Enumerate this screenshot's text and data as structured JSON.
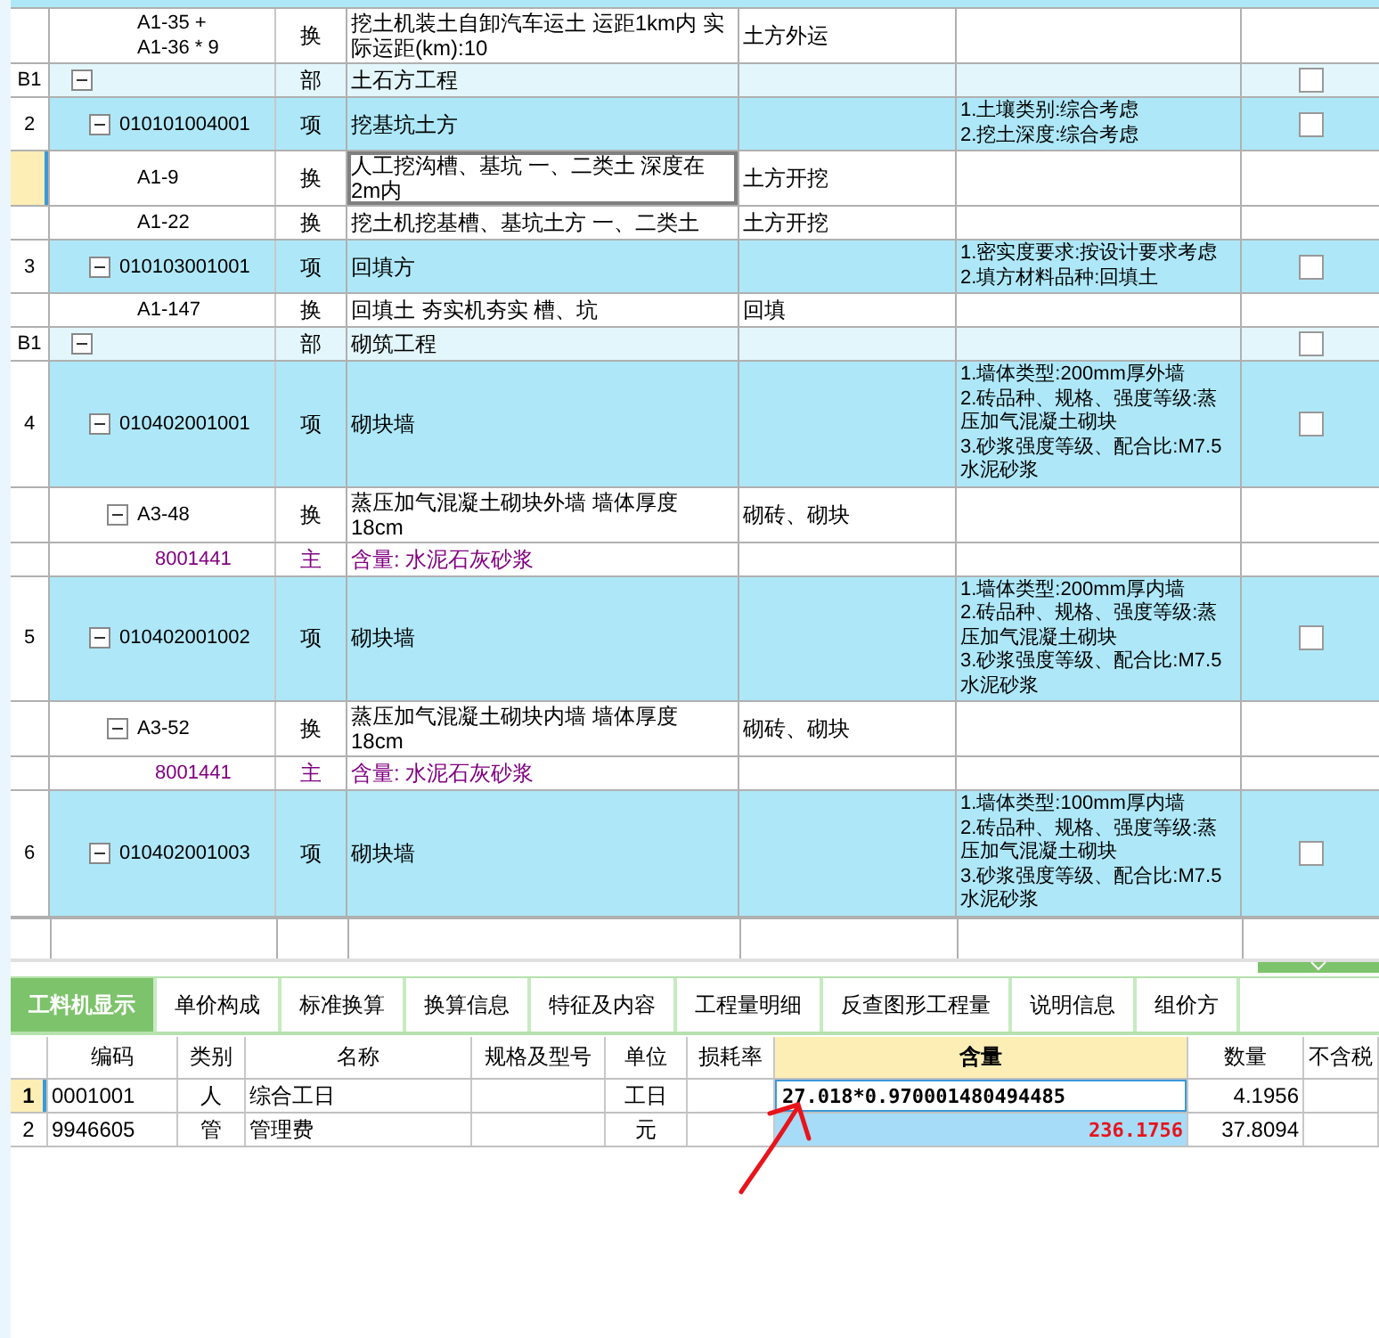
{
  "grid": {
    "rows": [
      {
        "kind": "quota",
        "code": "A1-35 +\nA1-36 * 9",
        "type": "换",
        "name": "挖土机装土自卸汽车运土 运距1km内  实际运距(km):10",
        "category": "土方外运",
        "selected": false
      },
      {
        "kind": "section",
        "no": "B1",
        "code": "",
        "type": "部",
        "name": "土石方工程",
        "expanded": true,
        "checked": false,
        "selected": false,
        "children": [
          {
            "kind": "item",
            "no": "2",
            "code": "010101004001",
            "type": "项",
            "name": "挖基坑土方",
            "features": "1.土壤类别:综合考虑\n2.挖土深度:综合考虑",
            "expanded": true,
            "checked": false,
            "selected": false,
            "children": [
              {
                "kind": "quota",
                "code": "A1-9",
                "type": "换",
                "name": "人工挖沟槽、基坑 一、二类土 深度在2m内",
                "category": "土方开挖",
                "selected": true
              },
              {
                "kind": "quota",
                "code": "A1-22",
                "type": "换",
                "name": "挖土机挖基槽、基坑土方 一、二类土",
                "category": "土方开挖",
                "selected": false
              }
            ]
          },
          {
            "kind": "item",
            "no": "3",
            "code": "010103001001",
            "type": "项",
            "name": "回填方",
            "features": "1.密实度要求:按设计要求考虑\n2.填方材料品种:回填土",
            "expanded": true,
            "checked": false,
            "selected": false,
            "children": [
              {
                "kind": "quota",
                "code": "A1-147",
                "type": "换",
                "name": "回填土 夯实机夯实 槽、坑",
                "category": "回填",
                "selected": false
              }
            ]
          }
        ]
      },
      {
        "kind": "section",
        "no": "B1",
        "code": "",
        "type": "部",
        "name": "砌筑工程",
        "expanded": true,
        "checked": false,
        "selected": false,
        "children": [
          {
            "kind": "item",
            "no": "4",
            "code": "010402001001",
            "type": "项",
            "name": "砌块墙",
            "features": "1.墙体类型:200mm厚外墙\n2.砖品种、规格、强度等级:蒸压加气混凝土砌块\n3.砂浆强度等级、配合比:M7.5水泥砂浆",
            "expanded": true,
            "checked": false,
            "selected": false,
            "children": [
              {
                "kind": "quota",
                "code": "A3-48",
                "type": "换",
                "name": "蒸压加气混凝土砌块外墙 墙体厚度 18cm",
                "category": "砌砖、砌块",
                "expanded": true,
                "selected": false,
                "children": [
                  {
                    "kind": "material",
                    "code": "8001441",
                    "type": "主",
                    "name": "含量: 水泥石灰砂浆",
                    "selected": false
                  }
                ]
              }
            ]
          },
          {
            "kind": "item",
            "no": "5",
            "code": "010402001002",
            "type": "项",
            "name": "砌块墙",
            "features": "1.墙体类型:200mm厚内墙\n2.砖品种、规格、强度等级:蒸压加气混凝土砌块\n3.砂浆强度等级、配合比:M7.5水泥砂浆",
            "expanded": true,
            "checked": false,
            "selected": false,
            "children": [
              {
                "kind": "quota",
                "code": "A3-52",
                "type": "换",
                "name": "蒸压加气混凝土砌块内墙 墙体厚度 18cm",
                "category": "砌砖、砌块",
                "expanded": true,
                "selected": false,
                "children": [
                  {
                    "kind": "material",
                    "code": "8001441",
                    "type": "主",
                    "name": "含量: 水泥石灰砂浆",
                    "selected": false
                  }
                ]
              }
            ]
          },
          {
            "kind": "item",
            "no": "6",
            "code": "010402001003",
            "type": "项",
            "name": "砌块墙",
            "features": "1.墙体类型:100mm厚内墙\n2.砖品种、规格、强度等级:蒸压加气混凝土砌块\n3.砂浆强度等级、配合比:M7.5水泥砂浆",
            "expanded": true,
            "checked": false,
            "selected": false
          }
        ]
      }
    ]
  },
  "tabs": [
    {
      "label": "工料机显示",
      "selected": true
    },
    {
      "label": "单价构成",
      "selected": false
    },
    {
      "label": "标准换算",
      "selected": false
    },
    {
      "label": "换算信息",
      "selected": false
    },
    {
      "label": "特征及内容",
      "selected": false
    },
    {
      "label": "工程量明细",
      "selected": false
    },
    {
      "label": "反查图形工程量",
      "selected": false
    },
    {
      "label": "说明信息",
      "selected": false
    },
    {
      "label": "组价方",
      "selected": false
    }
  ],
  "resources": {
    "columns": [
      {
        "label": "编码",
        "selected": false
      },
      {
        "label": "类别",
        "selected": false
      },
      {
        "label": "名称",
        "selected": false
      },
      {
        "label": "规格及型号",
        "selected": false
      },
      {
        "label": "单位",
        "selected": false
      },
      {
        "label": "损耗率",
        "selected": false
      },
      {
        "label": "含量",
        "selected": true
      },
      {
        "label": "数量",
        "selected": false
      },
      {
        "label": "不含税",
        "selected": false
      }
    ],
    "rows": [
      {
        "no": "1",
        "selected": true,
        "cells": [
          "0001001",
          "人",
          "综合工日",
          "",
          "工日",
          "",
          "27.018*0.970001480494485",
          "4.1956",
          ""
        ]
      },
      {
        "no": "2",
        "selected": false,
        "cells": [
          "9946605",
          "管",
          "管理费",
          "",
          "元",
          "",
          "236.1756",
          "37.8094",
          ""
        ]
      }
    ]
  }
}
